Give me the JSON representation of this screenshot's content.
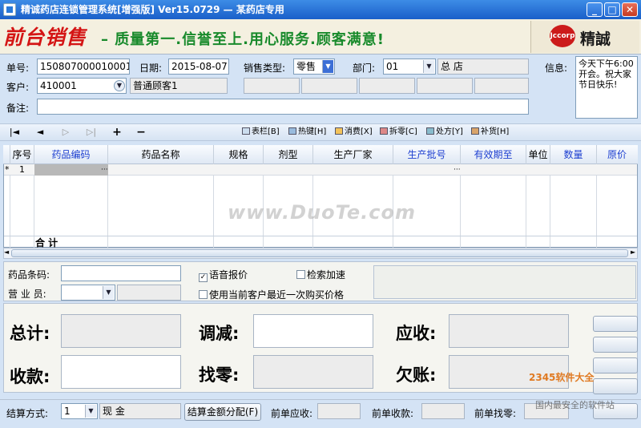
{
  "window": {
    "title": "精诚药店连锁管理系统[增强版] Ver15.0729 — 某药店专用"
  },
  "banner": {
    "logo_text": "前台销售",
    "slogan": "– 质量第一.信誉至上.用心服务.顾客满意!",
    "brand_circle": "Jccorp",
    "brand_text": "精誠"
  },
  "header": {
    "order_no_label": "单号:",
    "order_no": "150807000010001",
    "date_label": "日期:",
    "date": "2015-08-07",
    "sale_type_label": "销售类型:",
    "sale_type": "零售",
    "dept_label": "部门:",
    "dept_code": "01",
    "dept_name": "总  店",
    "customer_label": "客户:",
    "customer_code": "410001",
    "customer_name": "普通顾客1",
    "note_label": "备注:",
    "note": "",
    "info_label": "信息:",
    "info_text": "今天下午6:00开会。祝大家节日快乐!"
  },
  "toolbar": {
    "nav_first": "|◄",
    "nav_prev": "◄",
    "nav_next": "▷",
    "nav_last": "▷|",
    "add": "+",
    "remove": "−",
    "table_col": "表栏[B]",
    "hotkey": "热键[H]",
    "consume": "消费[X]",
    "split": "拆零[C]",
    "prescription": "处方[Y]",
    "restock": "补货[H]"
  },
  "grid": {
    "columns": [
      "序号",
      "药品编码",
      "药品名称",
      "规格",
      "剂型",
      "生产厂家",
      "生产批号",
      "有效期至",
      "单位",
      "数量",
      "原价"
    ],
    "row_marker": "*",
    "row1_index": "1",
    "total_label": "合  计"
  },
  "panel": {
    "barcode_label": "药品条码:",
    "barcode": "",
    "salesperson_label": "营 业 员:",
    "salesperson": "",
    "voice_price_label": "语音报价",
    "voice_price_checked": true,
    "search_speed_label": "检索加速",
    "search_speed_checked": false,
    "last_price_label": "使用当前客户最近一次购买价格",
    "last_price_checked": false
  },
  "summary": {
    "total_label": "总计:",
    "adjust_label": "调减:",
    "receivable_label": "应收:",
    "payment_label": "收款:",
    "change_label": "找零:",
    "debt_label": "欠账:"
  },
  "footer": {
    "settle_label": "结算方式:",
    "settle_code": "1",
    "settle_name": "现  金",
    "allocate_button": "结算金额分配(F)",
    "prev_receivable_label": "前单应收:",
    "prev_received_label": "前单收款:",
    "prev_change_label": "前单找零:"
  },
  "watermarks": {
    "main": "www.DuoTe.com",
    "corner_top": "2345软件大全",
    "corner_bottom": "国内最安全的软件站"
  }
}
